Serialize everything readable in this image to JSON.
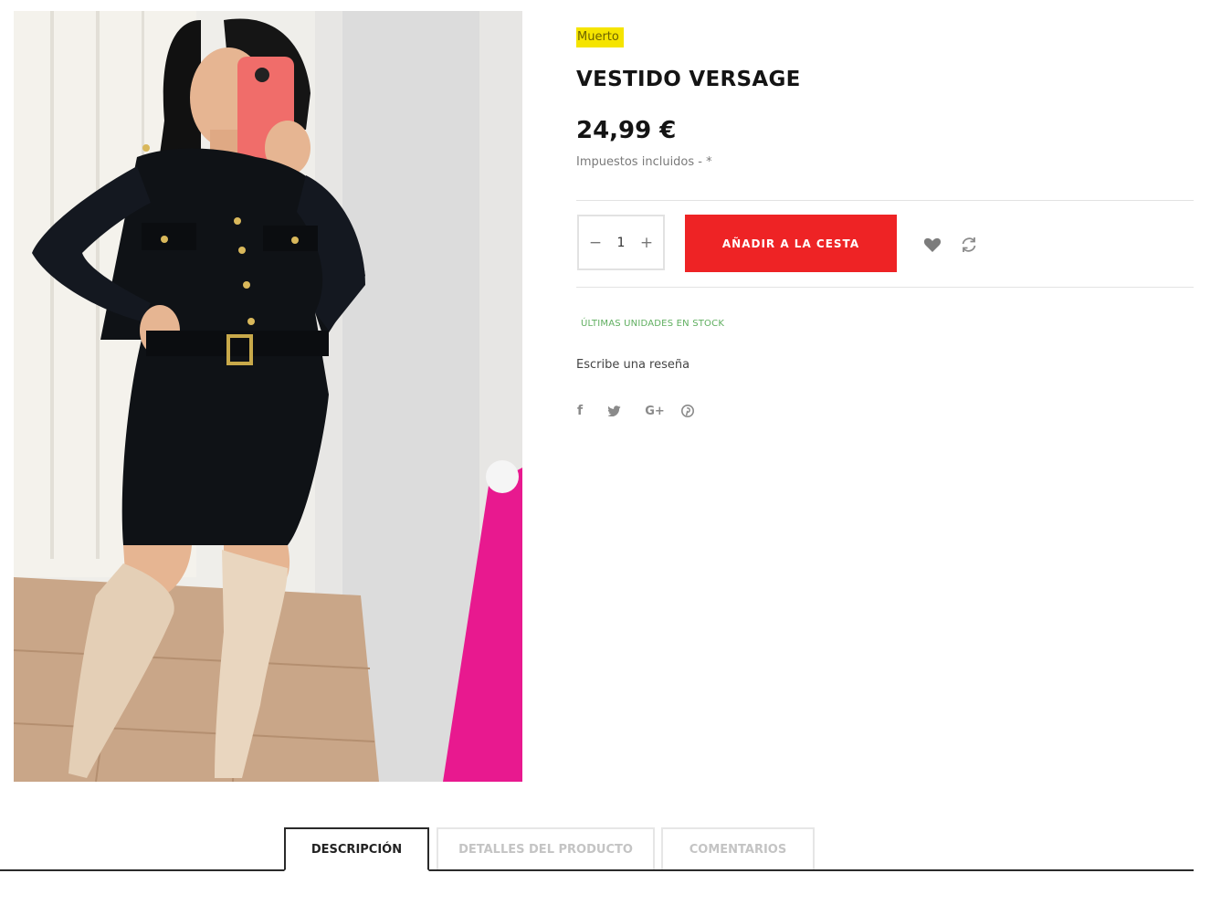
{
  "product": {
    "brand": "Muerto",
    "title": "VESTIDO VERSAGE",
    "price": "24,99 €",
    "tax_note": "Impuestos incluidos - *",
    "stock_status": "ÚLTIMAS UNIDADES EN STOCK",
    "review_link": "Escribe una reseña"
  },
  "cart": {
    "quantity": "1",
    "minus_symbol": "−",
    "plus_symbol": "+",
    "add_to_cart_label": "AÑADIR A LA CESTA"
  },
  "colors": {
    "accent_red": "#ee2325",
    "badge_yellow": "#f5e400",
    "stock_green": "#5fae5f"
  },
  "icons": {
    "wishlist": "heart-icon",
    "compare": "refresh-icon",
    "social": [
      "facebook-icon",
      "twitter-icon",
      "google-plus-icon",
      "pinterest-icon"
    ]
  },
  "social_glyphs": {
    "facebook": "f",
    "google_plus": "G+"
  },
  "tabs": [
    {
      "label": "DESCRIPCIÓN",
      "active": true
    },
    {
      "label": "DETALLES DEL PRODUCTO",
      "active": false
    },
    {
      "label": "COMENTARIOS",
      "active": false
    }
  ]
}
